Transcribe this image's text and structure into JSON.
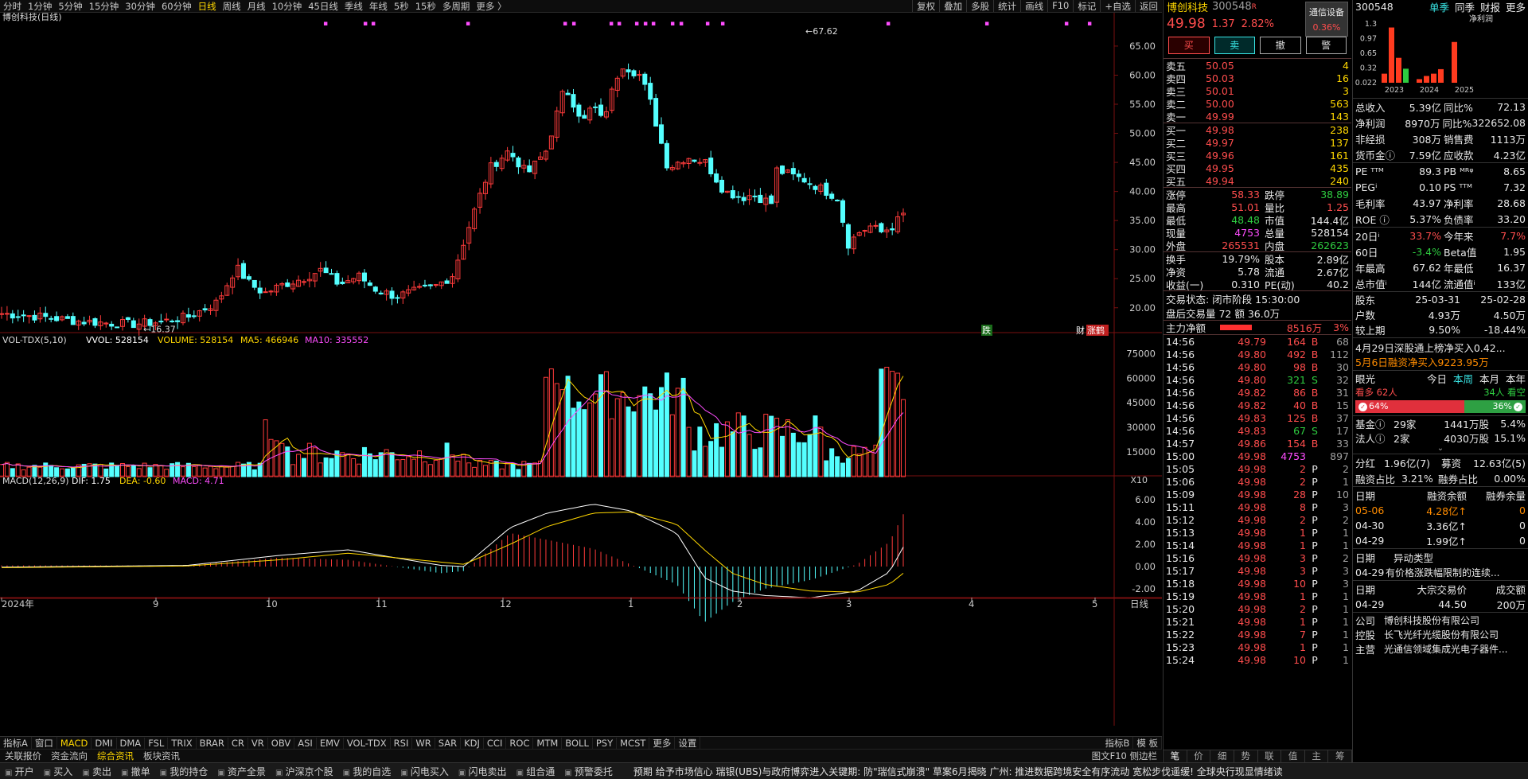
{
  "topbar": {
    "periods": [
      "分时",
      "1分钟",
      "5分钟",
      "15分钟",
      "30分钟",
      "60分钟",
      "日线",
      "周线",
      "月线",
      "10分钟",
      "45日线",
      "季线",
      "年线",
      "5秒",
      "15秒",
      "多周期",
      "更多 〉"
    ],
    "active_period": "日线",
    "right_tools": [
      "复权",
      "叠加",
      "多股",
      "统计",
      "画线",
      "F10",
      "标记",
      "+自选",
      "返回"
    ]
  },
  "main_chart": {
    "title": "博创科技(日线)",
    "price_ticks": [
      "65.00",
      "60.00",
      "55.00",
      "50.00",
      "45.00",
      "40.00",
      "35.00",
      "30.00",
      "25.00",
      "20.00"
    ],
    "high_label": "67.62",
    "low_label": "16.37",
    "markers": [
      "跌",
      "财",
      "涨鹤"
    ]
  },
  "volume_chart": {
    "title": "VOL-TDX(5,10)",
    "vvol": "VVOL: 528154",
    "volume": "VOLUME: 528154",
    "ma5": "MA5: 466946",
    "ma10": "MA10: 335552",
    "ticks": [
      "75000",
      "60000",
      "45000",
      "30000",
      "15000"
    ],
    "unit": "X10"
  },
  "macd_chart": {
    "title": "MACD(12,26,9)",
    "dif": "DIF: 1.75",
    "dea": "DEA: -0.60",
    "macd": "MACD: 4.71",
    "ticks": [
      "6.00",
      "4.00",
      "2.00",
      "0.00",
      "-2.00"
    ]
  },
  "x_axis": {
    "labels": [
      "2024年",
      "9",
      "10",
      "11",
      "12",
      "1",
      "2",
      "3",
      "4",
      "5"
    ],
    "right_label": "日线"
  },
  "bottom_tabs": [
    "指标A",
    "窗口",
    "MACD",
    "DMI",
    "DMA",
    "FSL",
    "TRIX",
    "BRAR",
    "CR",
    "VR",
    "OBV",
    "ASI",
    "EMV",
    "VOL-TDX",
    "RSI",
    "WR",
    "SAR",
    "KDJ",
    "CCI",
    "ROC",
    "MTM",
    "BOLL",
    "PSY",
    "MCST",
    "更多",
    "设置"
  ],
  "bottom_tabs_active": "MACD",
  "bottom_tabs_right": [
    "指标B",
    "模 板"
  ],
  "info_tabs": [
    "关联报价",
    "资金流向",
    "综合资讯",
    "板块资讯"
  ],
  "info_tabs_right": "图文F10  侧边栏",
  "stock": {
    "name": "博创科技",
    "code": "300548",
    "badge": "R",
    "price": "49.98",
    "change": "1.37",
    "pct": "2.82%",
    "broker": "通信设备",
    "broker_pct": "0.36%",
    "buttons": [
      "买",
      "卖",
      "撤",
      "警"
    ]
  },
  "order_book": {
    "sells": [
      {
        "label": "卖五",
        "price": "50.05",
        "vol": "4"
      },
      {
        "label": "卖四",
        "price": "50.03",
        "vol": "16"
      },
      {
        "label": "卖三",
        "price": "50.01",
        "vol": "3"
      },
      {
        "label": "卖二",
        "price": "50.00",
        "vol": "563"
      },
      {
        "label": "卖一",
        "price": "49.99",
        "vol": "143"
      }
    ],
    "buys": [
      {
        "label": "买一",
        "price": "49.98",
        "vol": "238"
      },
      {
        "label": "买二",
        "price": "49.97",
        "vol": "137"
      },
      {
        "label": "买三",
        "price": "49.96",
        "vol": "161"
      },
      {
        "label": "买四",
        "price": "49.95",
        "vol": "435"
      },
      {
        "label": "买五",
        "price": "49.94",
        "vol": "240"
      }
    ]
  },
  "quote_stats": [
    {
      "l1": "涨停",
      "v1": "58.33",
      "c1": "red",
      "l2": "跌停",
      "v2": "38.89",
      "c2": "green"
    },
    {
      "l1": "最高",
      "v1": "51.01",
      "c1": "red",
      "l2": "量比",
      "v2": "1.25",
      "c2": "red"
    },
    {
      "l1": "最低",
      "v1": "48.48",
      "c1": "green",
      "l2": "市值",
      "v2": "144.4亿",
      "c2": "white"
    },
    {
      "l1": "现量",
      "v1": "4753",
      "c1": "magenta",
      "l2": "总量",
      "v2": "528154",
      "c2": "white"
    },
    {
      "l1": "外盘",
      "v1": "265531",
      "c1": "red",
      "l2": "内盘",
      "v2": "262623",
      "c2": "green"
    }
  ],
  "quote_stats2": [
    {
      "l1": "换手",
      "v1": "19.79%",
      "l2": "股本",
      "v2": "2.89亿"
    },
    {
      "l1": "净资",
      "v1": "5.78",
      "l2": "流通",
      "v2": "2.67亿"
    },
    {
      "l1": "收益(一)",
      "v1": "0.310",
      "l2": "PE(动)",
      "v2": "40.2"
    }
  ],
  "trade_status": "交易状态: 闭市阶段 15:30:00",
  "after_hours": "盘后交易量 72 额 36.0万",
  "main_flow": {
    "label": "主力净额",
    "value": "8516万",
    "pct": "3%"
  },
  "ticks": [
    {
      "t": "14:56",
      "p": "49.79",
      "v": "164",
      "d": "B",
      "n": "68"
    },
    {
      "t": "14:56",
      "p": "49.80",
      "v": "492",
      "d": "B",
      "n": "112"
    },
    {
      "t": "14:56",
      "p": "49.80",
      "v": "98",
      "d": "B",
      "n": "30"
    },
    {
      "t": "14:56",
      "p": "49.80",
      "v": "321",
      "d": "S",
      "n": "32"
    },
    {
      "t": "14:56",
      "p": "49.82",
      "v": "86",
      "d": "B",
      "n": "31"
    },
    {
      "t": "14:56",
      "p": "49.82",
      "v": "40",
      "d": "B",
      "n": "15"
    },
    {
      "t": "14:56",
      "p": "49.83",
      "v": "125",
      "d": "B",
      "n": "37"
    },
    {
      "t": "14:56",
      "p": "49.83",
      "v": "67",
      "d": "S",
      "n": "17"
    },
    {
      "t": "14:57",
      "p": "49.86",
      "v": "154",
      "d": "B",
      "n": "33"
    },
    {
      "t": "15:00",
      "p": "49.98",
      "v": "4753",
      "d": "",
      "n": "897"
    },
    {
      "t": "15:05",
      "p": "49.98",
      "v": "2",
      "d": "P",
      "n": "2"
    },
    {
      "t": "15:06",
      "p": "49.98",
      "v": "2",
      "d": "P",
      "n": "1"
    },
    {
      "t": "15:09",
      "p": "49.98",
      "v": "28",
      "d": "P",
      "n": "10"
    },
    {
      "t": "15:11",
      "p": "49.98",
      "v": "8",
      "d": "P",
      "n": "3"
    },
    {
      "t": "15:12",
      "p": "49.98",
      "v": "2",
      "d": "P",
      "n": "2"
    },
    {
      "t": "15:13",
      "p": "49.98",
      "v": "1",
      "d": "P",
      "n": "1"
    },
    {
      "t": "15:14",
      "p": "49.98",
      "v": "1",
      "d": "P",
      "n": "1"
    },
    {
      "t": "15:16",
      "p": "49.98",
      "v": "3",
      "d": "P",
      "n": "2"
    },
    {
      "t": "15:17",
      "p": "49.98",
      "v": "3",
      "d": "P",
      "n": "3"
    },
    {
      "t": "15:18",
      "p": "49.98",
      "v": "10",
      "d": "P",
      "n": "3"
    },
    {
      "t": "15:19",
      "p": "49.98",
      "v": "1",
      "d": "P",
      "n": "1"
    },
    {
      "t": "15:20",
      "p": "49.98",
      "v": "2",
      "d": "P",
      "n": "1"
    },
    {
      "t": "15:21",
      "p": "49.98",
      "v": "1",
      "d": "P",
      "n": "1"
    },
    {
      "t": "15:22",
      "p": "49.98",
      "v": "7",
      "d": "P",
      "n": "1"
    },
    {
      "t": "15:23",
      "p": "49.98",
      "v": "1",
      "d": "P",
      "n": "1"
    },
    {
      "t": "15:24",
      "p": "49.98",
      "v": "10",
      "d": "P",
      "n": "1"
    }
  ],
  "right_tabs": [
    "笔",
    "价",
    "细",
    "势",
    "联",
    "值",
    "主",
    "筹"
  ],
  "f10": {
    "header_code": "300548",
    "header_tabs": [
      "单季",
      "同季",
      "财报",
      "更多"
    ],
    "chart_title": "净利润",
    "chart_yticks": [
      "1.3",
      "0.97",
      "0.65",
      "0.32",
      "0.022"
    ],
    "chart_years": [
      "2023",
      "2024",
      "2025"
    ],
    "chart_bars": [
      {
        "year": "2023",
        "q": 1,
        "value": 0.2,
        "color": "red"
      },
      {
        "year": "2023",
        "q": 2,
        "value": 1.22,
        "color": "red"
      },
      {
        "year": "2023",
        "q": 3,
        "value": 0.55,
        "color": "red"
      },
      {
        "year": "2023",
        "q": 4,
        "value": 0.31,
        "color": "green"
      },
      {
        "year": "2024",
        "q": 1,
        "value": 0.08,
        "color": "red"
      },
      {
        "year": "2024",
        "q": 2,
        "value": 0.15,
        "color": "red"
      },
      {
        "year": "2024",
        "q": 3,
        "value": 0.2,
        "color": "red"
      },
      {
        "year": "2024",
        "q": 4,
        "value": 0.3,
        "color": "red"
      },
      {
        "year": "2025",
        "q": 1,
        "value": 0.9,
        "color": "red"
      }
    ],
    "fin": [
      {
        "l1": "总收入",
        "v1": "5.39亿",
        "l2": "同比%",
        "v2": "72.13"
      },
      {
        "l1": "净利润",
        "v1": "8970万",
        "l2": "同比%",
        "v2": "322652.08"
      },
      {
        "l1": "非经损",
        "v1": "308万",
        "l2": "销售费",
        "v2": "1113万"
      },
      {
        "l1": "货币金ⓘ",
        "v1": "7.59亿",
        "l2": "应收款",
        "v2": "4.23亿"
      }
    ],
    "val": [
      {
        "l1": "PE ᵀᵀᴹ",
        "v1": "89.3",
        "l2": "PB ᴹᴿᵠ",
        "v2": "8.65"
      },
      {
        "l1": "PEGⁱ",
        "v1": "0.10",
        "l2": "PS ᵀᵀᴹ",
        "v2": "7.32"
      },
      {
        "l1": "毛利率",
        "v1": "43.97",
        "l2": "净利率",
        "v2": "28.68"
      },
      {
        "l1": "ROE ⓘ",
        "v1": "5.37%",
        "l2": "负债率",
        "v2": "33.20"
      }
    ],
    "perf": [
      {
        "l1": "20日ⁱ",
        "v1": "33.7%",
        "c1": "red",
        "l2": "今年来",
        "v2": "7.7%",
        "c2": "red"
      },
      {
        "l1": "60日",
        "v1": "-3.4%",
        "c1": "green",
        "l2": "Beta值",
        "v2": "1.95",
        "c2": "white"
      },
      {
        "l1": "年最高",
        "v1": "67.62",
        "c1": "white",
        "l2": "年最低",
        "v2": "16.37",
        "c2": "white"
      },
      {
        "l1": "总市值ⁱ",
        "v1": "144亿",
        "c1": "white",
        "l2": "流通值ⁱ",
        "v2": "133亿",
        "c2": "white"
      }
    ],
    "holders": [
      {
        "l1": "股东",
        "v1": "25-03-31",
        "v2": "25-02-28"
      },
      {
        "l1": "户数",
        "v1": "4.93万",
        "v2": "4.50万"
      },
      {
        "l1": "较上期",
        "v1": "9.50%",
        "v2": "-18.44%"
      }
    ],
    "news1": "4月29日深股通上榜净买入0.42...",
    "news2": "5月6日融资净买入9223.95万",
    "opinion": {
      "label": "眼光",
      "tabs": [
        "今日",
        "本周",
        "本月",
        "本年"
      ],
      "active": "本周",
      "bull": "看多 62人",
      "bear": "34人 看空",
      "bull_pct": "64%",
      "bear_pct": "36%"
    },
    "funds": [
      {
        "l": "基金ⓘ",
        "a": "29家",
        "b": "1441万股",
        "c": "5.4%"
      },
      {
        "l": "法人ⓘ",
        "a": "2家",
        "b": "4030万股",
        "c": "15.1%"
      }
    ],
    "dividend": {
      "l": "分红",
      "a": "1.96亿(7)",
      "b": "募资",
      "c": "12.63亿(5)"
    },
    "margin_ratio": {
      "l1": "融资占比",
      "v1": "3.21%",
      "l2": "融券占比",
      "v2": "0.00%"
    },
    "margin_header": [
      "日期",
      "融资余额",
      "融券余量"
    ],
    "margin_rows": [
      {
        "d": "05-06",
        "a": "4.28亿↑",
        "b": "0"
      },
      {
        "d": "04-30",
        "a": "3.36亿↑",
        "b": "0"
      },
      {
        "d": "04-29",
        "a": "1.99亿↑",
        "b": "0"
      }
    ],
    "abnormal_header": [
      "日期",
      "异动类型"
    ],
    "abnormal_row": {
      "d": "04-29",
      "t": "有价格涨跌幅限制的连续..."
    },
    "block_header": [
      "日期",
      "大宗交易价",
      "成交额"
    ],
    "block_row": {
      "d": "04-29",
      "p": "44.50",
      "a": "200万"
    },
    "company": [
      {
        "l": "公司",
        "v": "博创科技股份有限公司"
      },
      {
        "l": "控股",
        "v": "长飞光纤光缆股份有限公司"
      },
      {
        "l": "主营",
        "v": "光通信领域集成光电子器件..."
      }
    ]
  },
  "taskbar": [
    "开户",
    "买入",
    "卖出",
    "撤单",
    "我的持仓",
    "资产全景",
    "沪深京个股",
    "我的自选",
    "闪电买入",
    "闪电卖出",
    "组合通",
    "预警委托"
  ],
  "ticker_text": "预期 给予市场信心    瑞银(UBS)与政府博弈进入关键期: 防\"瑞信式崩溃\" 草案6月揭晓    广州: 推进数据跨境安全有序流动    宽松步伐遥缓! 全球央行现显情绪读"
}
